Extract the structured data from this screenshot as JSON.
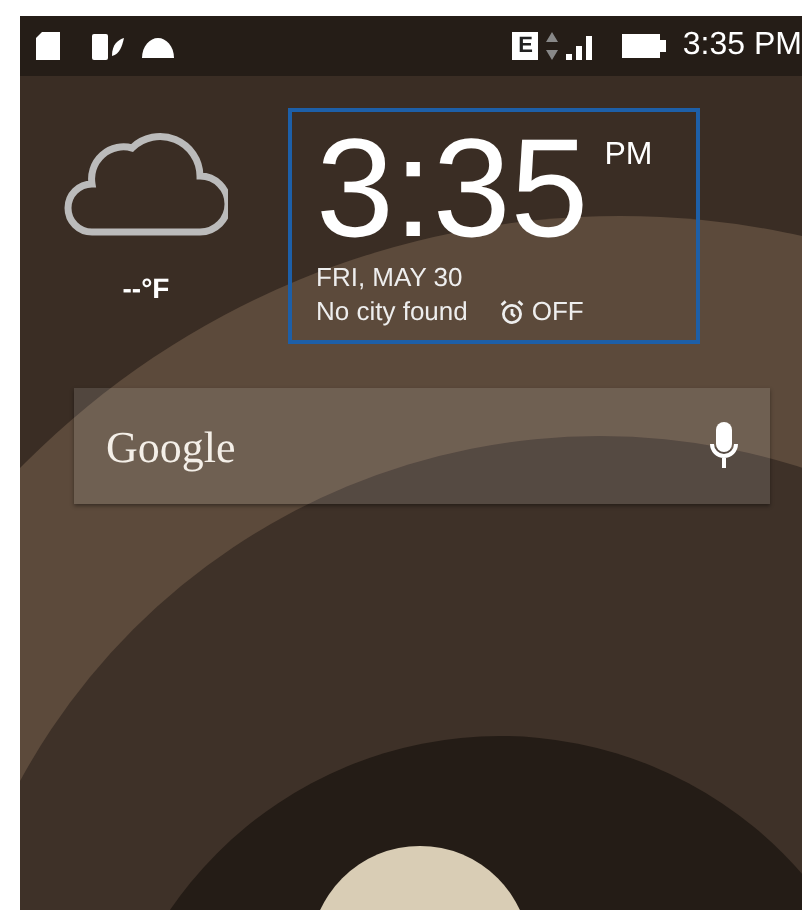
{
  "status_bar": {
    "network_badge": "E",
    "time": "3:35 PM"
  },
  "weather": {
    "temperature": "--°F"
  },
  "clock": {
    "time": "3:35",
    "ampm": "PM",
    "date": "FRI, MAY 30",
    "city": "No city found",
    "alarm": "OFF"
  },
  "search": {
    "logo": "Google"
  }
}
